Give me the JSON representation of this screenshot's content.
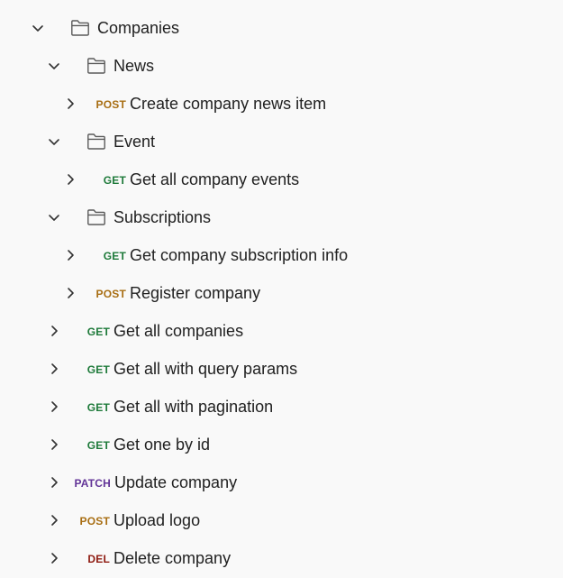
{
  "colors": {
    "get": "#1e7a3a",
    "post": "#a86e13",
    "patch": "#623497",
    "del": "#8e1a10",
    "text": "#212121",
    "icon": "#5a5a5a"
  },
  "tree": {
    "root": {
      "label": "Companies",
      "expanded": true,
      "icon": "folder-icon"
    },
    "folders": [
      {
        "label": "News",
        "expanded": true,
        "icon": "folder-icon",
        "requests": [
          {
            "method": "POST",
            "label": "Create company news item"
          }
        ]
      },
      {
        "label": "Event",
        "expanded": true,
        "icon": "folder-icon",
        "requests": [
          {
            "method": "GET",
            "label": "Get all company events"
          }
        ]
      },
      {
        "label": "Subscriptions",
        "expanded": true,
        "icon": "folder-icon",
        "requests": [
          {
            "method": "GET",
            "label": "Get company subscription info"
          },
          {
            "method": "POST",
            "label": "Register company"
          }
        ]
      }
    ],
    "requests": [
      {
        "method": "GET",
        "label": "Get all companies"
      },
      {
        "method": "GET",
        "label": "Get all with query params"
      },
      {
        "method": "GET",
        "label": "Get all with pagination"
      },
      {
        "method": "GET",
        "label": "Get one by id"
      },
      {
        "method": "PATCH",
        "label": "Update company"
      },
      {
        "method": "POST",
        "label": "Upload logo"
      },
      {
        "method": "DEL",
        "label": "Delete company"
      }
    ]
  }
}
